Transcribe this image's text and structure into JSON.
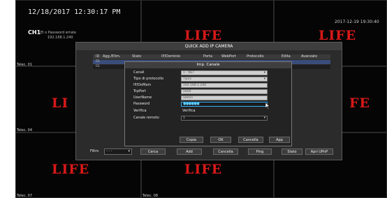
{
  "osd": {
    "datetime": "12/18/2017 12:30:17 PM",
    "channel": "CH1",
    "warning_line1": "El o Password errate",
    "warning_line2": "192.168.1.240",
    "corner_datetime": "2017-12-19 19:30:40"
  },
  "cells": {
    "label_01": "Telec. 01",
    "label_04": "Telec. 04",
    "label_07": "Telec. 07",
    "label_08": "Telec. 08"
  },
  "brand": {
    "logo_text": "LIFE",
    "logo_partial": "LI",
    "logo_partial_right": "FE"
  },
  "dialog": {
    "title": "QUICK ADD IP CAMERA",
    "columns": [
      "ID",
      "Agg./Elim.",
      "Stato",
      "IP/Dominio",
      "Porta",
      "WebPort",
      "Protocollo",
      "Edita",
      "Avanzato"
    ],
    "rows": [
      {
        "id": "01"
      },
      {
        "id": "01"
      }
    ],
    "filter_label": "Filtro",
    "filter_value": "- - -",
    "buttons": {
      "search": "Cerca",
      "add": "Add",
      "delete": "Cancella",
      "ping": "Ping",
      "status": "Stato",
      "upnp": "Apri UPnP"
    }
  },
  "subdialog": {
    "title": "Imp. Canale",
    "fields": {
      "channel_label": "Canali",
      "channel_value": "1 - NET",
      "protocol_label": "Tipo di protocollo",
      "protocol_value": "Tipo1",
      "ip_label": "IP/DoMain",
      "ip_value": "192.168.1.240",
      "port_label": "TcpPort",
      "port_value": "5000",
      "username_label": "UserName",
      "username_value": "admin",
      "password_label": "Password",
      "password_value": "●●●●●●",
      "verify_label": "Verifica",
      "verify_value": "Verifica",
      "remote_channel_label": "Canale remoto",
      "remote_channel_value": "1"
    },
    "buttons": {
      "copy": "Copia",
      "ok": "OK",
      "cancel": "Cancella",
      "apply": "App"
    }
  },
  "colors": {
    "logo_red": "#d81818",
    "focus_blue": "#3ab0ff",
    "panel": "#2b2b2b"
  }
}
